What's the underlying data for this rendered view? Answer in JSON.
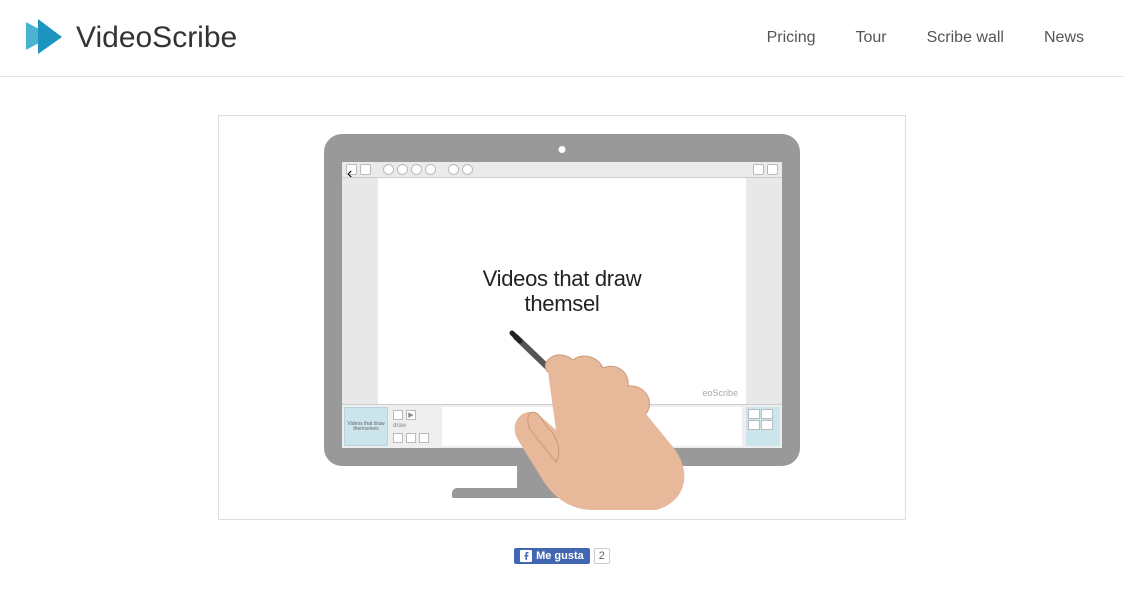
{
  "brand": "VideoScribe",
  "nav": [
    "Pricing",
    "Tour",
    "Scribe wall",
    "News"
  ],
  "hero": {
    "canvas_line1": "Videos that draw",
    "canvas_line2": "themsel",
    "watermark": "eoScribe",
    "thumb_label": "Videos that draw themselves",
    "thumb_sub": "draw"
  },
  "social": {
    "like_label": "Me gusta",
    "like_count": "2"
  }
}
